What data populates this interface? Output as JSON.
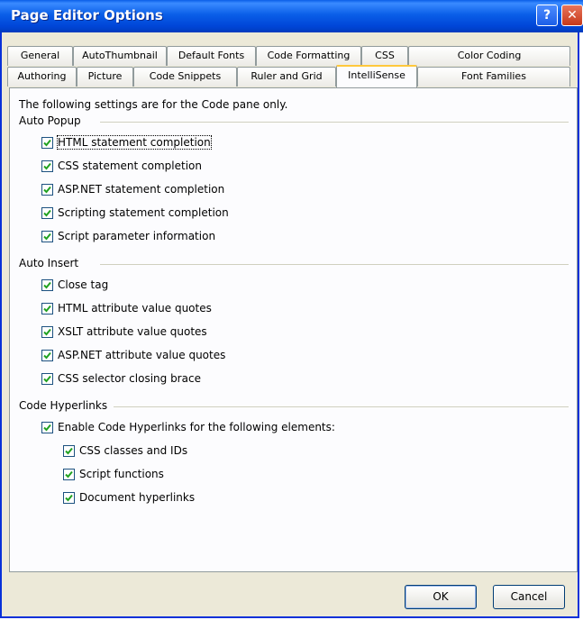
{
  "window": {
    "title": "Page Editor Options"
  },
  "tabs_row1": [
    "General",
    "AutoThumbnail",
    "Default Fonts",
    "Code Formatting",
    "CSS",
    "Color Coding"
  ],
  "tabs_row2": [
    "Authoring",
    "Picture",
    "Code Snippets",
    "Ruler and Grid",
    "IntelliSense",
    "Font Families"
  ],
  "active_tab": "IntelliSense",
  "intro_text": "The following settings are for the Code pane only.",
  "groups": {
    "auto_popup": {
      "label": "Auto Popup",
      "items": [
        {
          "label": "HTML statement completion",
          "checked": true
        },
        {
          "label": "CSS statement completion",
          "checked": true
        },
        {
          "label": "ASP.NET statement completion",
          "checked": true
        },
        {
          "label": "Scripting statement completion",
          "checked": true
        },
        {
          "label": "Script parameter information",
          "checked": true
        }
      ]
    },
    "auto_insert": {
      "label": "Auto Insert",
      "items": [
        {
          "label": "Close tag",
          "checked": true
        },
        {
          "label": "HTML attribute value quotes",
          "checked": true
        },
        {
          "label": "XSLT attribute value quotes",
          "checked": true
        },
        {
          "label": "ASP.NET attribute value quotes",
          "checked": true
        },
        {
          "label": "CSS selector closing brace",
          "checked": true
        }
      ]
    },
    "code_hyperlinks": {
      "label": "Code Hyperlinks",
      "enable": {
        "label": "Enable Code Hyperlinks for the following elements:",
        "checked": true
      },
      "items": [
        {
          "label": "CSS classes and IDs",
          "checked": true
        },
        {
          "label": "Script functions",
          "checked": true
        },
        {
          "label": "Document hyperlinks",
          "checked": true
        }
      ]
    }
  },
  "buttons": {
    "ok": "OK",
    "cancel": "Cancel"
  },
  "icons": {
    "help": "help-icon",
    "close": "close-icon",
    "check": "checkmark-icon"
  },
  "colors": {
    "title_bar": "#0a5ee8",
    "dialog_bg": "#ece9d8",
    "tab_highlight": "#ffc83c",
    "check": "#21a121"
  }
}
